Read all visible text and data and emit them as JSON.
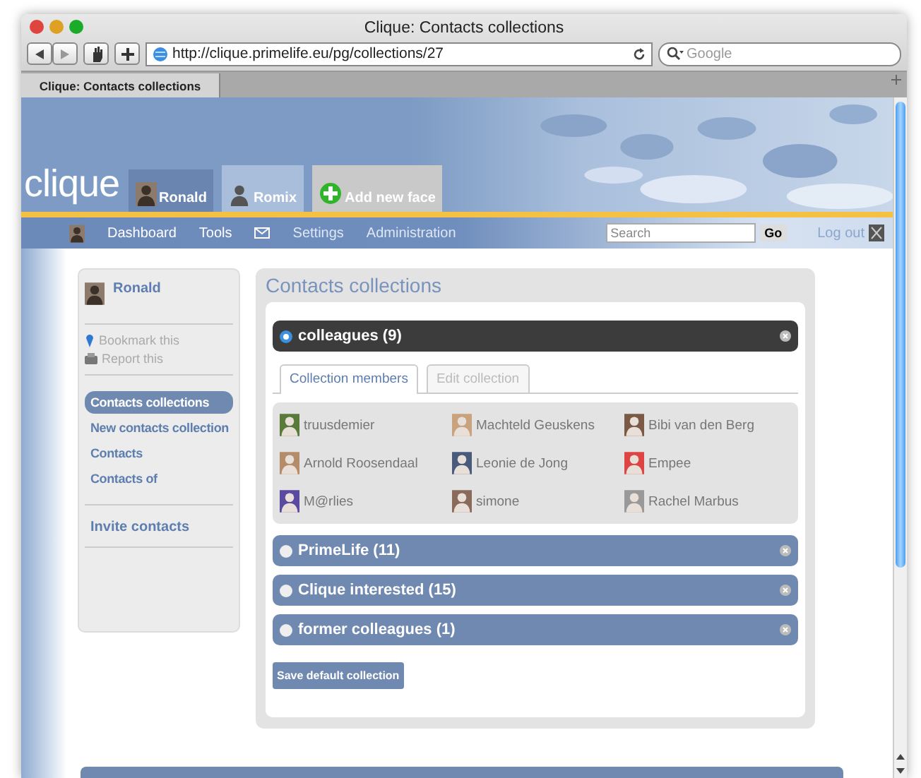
{
  "window": {
    "title": "Clique: Contacts collections"
  },
  "toolbar": {
    "url": "http://clique.primelife.eu/pg/collections/27",
    "search_placeholder": "Google"
  },
  "tabs": [
    {
      "label": "Clique: Contacts collections",
      "selected": true
    }
  ],
  "header": {
    "logo": "clique",
    "faces": [
      {
        "name": "Ronald",
        "selected": true
      },
      {
        "name": "Romix",
        "kind": "silhouette",
        "selected": false
      },
      {
        "name": "Add new face",
        "kind": "add"
      }
    ]
  },
  "nav": {
    "items": [
      {
        "label": "Dashboard",
        "kind": "link",
        "disabled": false
      },
      {
        "label": "Tools",
        "kind": "link",
        "disabled": false
      },
      {
        "kind": "mail",
        "disabled": false
      },
      {
        "label": "Settings",
        "kind": "link",
        "disabled": true
      },
      {
        "label": "Administration",
        "kind": "link",
        "disabled": true
      }
    ],
    "search_placeholder": "Search",
    "go": "Go",
    "logout": "Log out"
  },
  "sidebar": {
    "name": "Ronald",
    "actions": [
      {
        "label": "Bookmark this",
        "kind": "bookmark"
      },
      {
        "label": "Report this",
        "kind": "report"
      }
    ],
    "menu": [
      {
        "label": "Contacts collections",
        "selected": true
      },
      {
        "label": "New contacts collection",
        "selected": false
      },
      {
        "label": "Contacts",
        "selected": false
      },
      {
        "label": "Contacts of",
        "selected": false
      }
    ],
    "extra": [
      "Invite contacts"
    ]
  },
  "main": {
    "title": "Contacts collections",
    "collections": [
      {
        "name": "colleagues (9)",
        "expanded": true
      },
      {
        "name": "PrimeLife (11)",
        "expanded": false
      },
      {
        "name": "Clique interested (15)",
        "expanded": false
      },
      {
        "name": "former colleagues (1)",
        "expanded": false
      }
    ],
    "tabs": [
      {
        "label": "Collection members",
        "selected": true
      },
      {
        "label": "Edit collection",
        "selected": false
      }
    ],
    "members": [
      "truusdemier",
      "Machteld Geuskens",
      "Bibi van den Berg",
      "Arnold Roosendaal",
      "Leonie de Jong",
      "Empee",
      "M@rlies",
      "simone",
      "Rachel Marbus"
    ],
    "save_button": "Save default collection"
  }
}
